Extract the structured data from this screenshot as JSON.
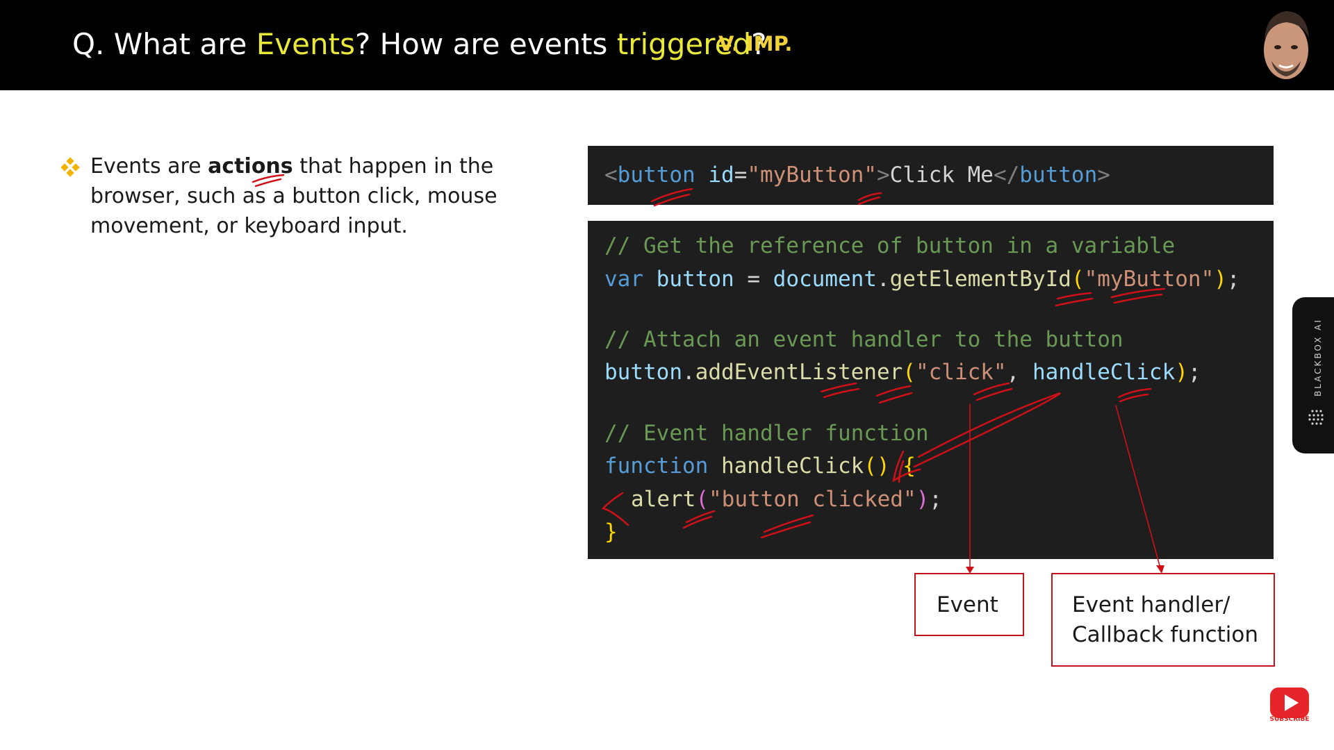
{
  "header": {
    "title_prefix": "Q. What are ",
    "title_events": "Events",
    "title_mid": "? How are events ",
    "title_triggered": "triggered",
    "title_suffix": "?",
    "importance_tag": "V. IMP."
  },
  "bullet": {
    "icon": "diamond-bullet-icon",
    "text_before": "Events are ",
    "text_bold": "actions",
    "text_after": " that happen in the browser, such as a button click, mouse movement, or keyboard input."
  },
  "html_snippet": {
    "lt": "<",
    "tag_open": "button",
    "attr_name": "id",
    "eq": "=",
    "attr_value": "\"myButton\"",
    "gt": ">",
    "inner_text": "Click Me",
    "close_lt": "</",
    "tag_close": "button",
    "close_gt": ">"
  },
  "js_snippet": {
    "comment1": "// Get the reference of button in a variable",
    "line2_kw": "var",
    "line2_var": "button",
    "line2_eq": " = ",
    "line2_obj": "document",
    "line2_dot": ".",
    "line2_fn": "getElementById",
    "line2_open": "(",
    "line2_str": "\"myButton\"",
    "line2_close": ")",
    "line2_semi": ";",
    "comment2": "// Attach an event handler to the button",
    "line4_var": "button",
    "line4_dot": ".",
    "line4_fn": "addEventListener",
    "line4_open": "(",
    "line4_str": "\"click\"",
    "line4_comma": ", ",
    "line4_arg": "handleClick",
    "line4_close": ")",
    "line4_semi": ";",
    "comment3": "// Event handler function",
    "line6_kw": "function",
    "line6_fn": "handleClick",
    "line6_parens": "()",
    "line6_brace": " {",
    "line7_fn": "alert",
    "line7_open": "(",
    "line7_str": "\"button clicked\"",
    "line7_close": ")",
    "line7_semi": ";",
    "line8_brace": "}"
  },
  "callouts": {
    "event_label": "Event",
    "handler_line1": "Event handler/",
    "handler_line2": "Callback function"
  },
  "side_tab": {
    "label": "BLACKBOX AI",
    "icon": "dot-grid-icon"
  },
  "subscribe": {
    "icon": "youtube-play-icon",
    "label": "SUBSCRIBE"
  },
  "colors": {
    "header_bg": "#000000",
    "highlight": "#e9e93a",
    "imp": "#f2d23a",
    "code_bg": "#1e1e1e",
    "annotation_red": "#c0121c"
  }
}
